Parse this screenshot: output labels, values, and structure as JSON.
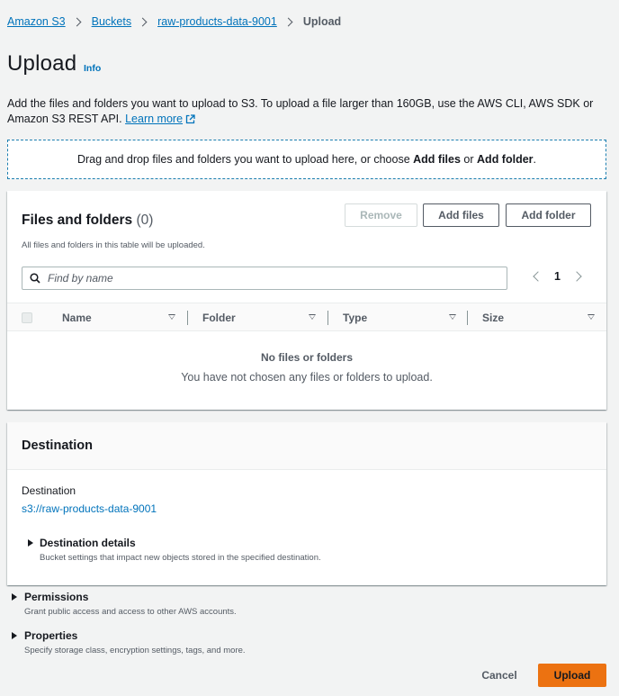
{
  "breadcrumb": {
    "items": [
      "Amazon S3",
      "Buckets",
      "raw-products-data-9001"
    ],
    "current": "Upload"
  },
  "page": {
    "title": "Upload",
    "info_label": "Info",
    "description": "Add the files and folders you want to upload to S3. To upload a file larger than 160GB, use the AWS CLI, AWS SDK or Amazon S3 REST API.",
    "learn_more": "Learn more"
  },
  "dropzone": {
    "text_prefix": "Drag and drop files and folders you want to upload here, or choose",
    "add_files": "Add files",
    "or": "or",
    "add_folder": "Add folder",
    "suffix": "."
  },
  "files_panel": {
    "title": "Files and folders",
    "count": "(0)",
    "subtitle": "All files and folders in this table will be uploaded.",
    "buttons": {
      "remove": "Remove",
      "add_files": "Add files",
      "add_folder": "Add folder"
    },
    "search_placeholder": "Find by name",
    "page_number": "1",
    "columns": [
      "Name",
      "Folder",
      "Type",
      "Size"
    ],
    "empty_title": "No files or folders",
    "empty_text": "You have not chosen any files or folders to upload."
  },
  "destination": {
    "header": "Destination",
    "label": "Destination",
    "uri": "s3://raw-products-data-9001",
    "details_title": "Destination details",
    "details_sub": "Bucket settings that impact new objects stored in the specified destination."
  },
  "permissions": {
    "title": "Permissions",
    "sub": "Grant public access and access to other AWS accounts."
  },
  "properties": {
    "title": "Properties",
    "sub": "Specify storage class, encryption settings, tags, and more."
  },
  "footer": {
    "cancel": "Cancel",
    "upload": "Upload"
  },
  "colors": {
    "link": "#0073bb",
    "primary_button": "#ec7211",
    "background": "#f2f3f3"
  }
}
